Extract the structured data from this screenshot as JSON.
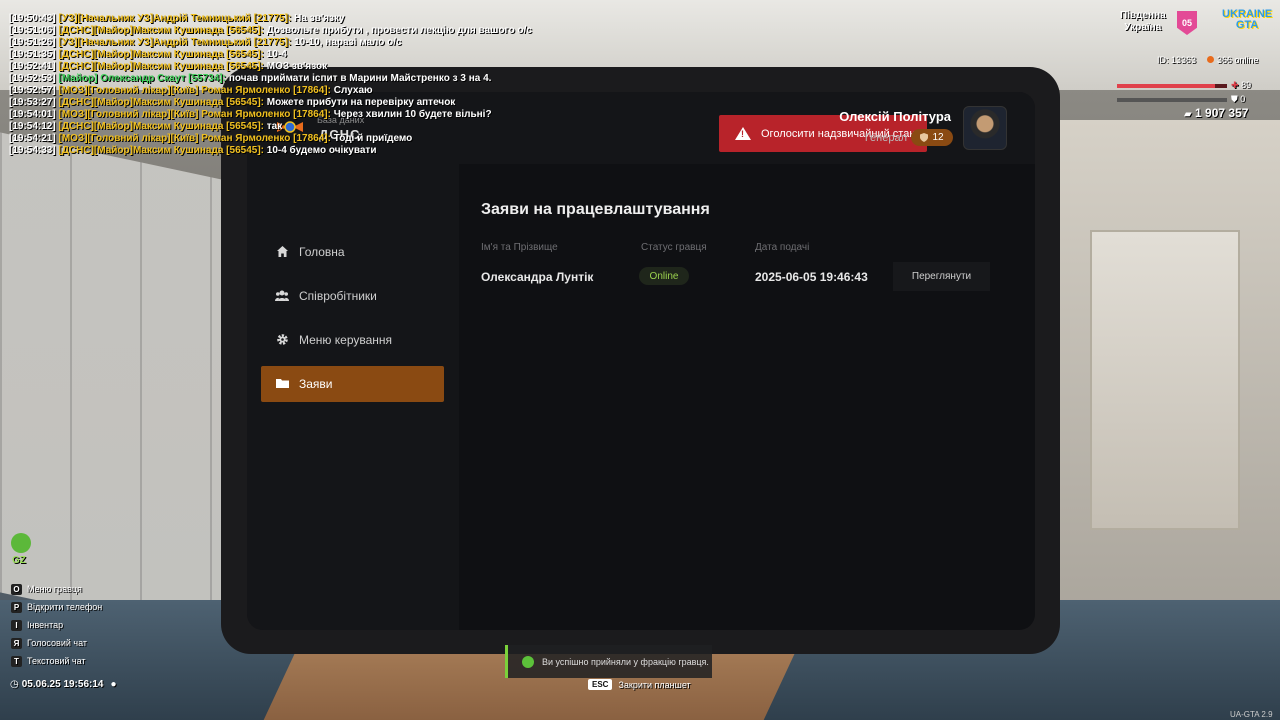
{
  "chat": [
    {
      "ts": "[19:50:43]",
      "name": "[УЗ][Начальник УЗ]Андрій Темницький [21775]:",
      "msg": "На зв'язку",
      "color": "gold"
    },
    {
      "ts": "[19:51:06]",
      "name": "[ДСНС][Майор]Максим Кушинада [56545]:",
      "msg": "Дозвольте прибути , провести лекцію для вашого о/с",
      "color": "gold"
    },
    {
      "ts": "[19:51:26]",
      "name": "[УЗ][Начальник УЗ]Андрій Темницький [21775]:",
      "msg": "10-10, наразі мало о/с",
      "color": "gold"
    },
    {
      "ts": "[19:51:35]",
      "name": "[ДСНС][Майор]Максим Кушинада [56545]:",
      "msg": "10-4",
      "color": "gold"
    },
    {
      "ts": "[19:52:41]",
      "name": "[ДСНС][Майор]Максим Кушинада [56545]:",
      "msg": "МОЗ зв'язок",
      "color": "gold"
    },
    {
      "ts": "[19:52:53]",
      "name": "[Майор] Олександр Скаут [55734]:",
      "msg": "почав приймати іспит в Марини Майстренко з 3 на 4.",
      "color": "green"
    },
    {
      "ts": "[19:52:57]",
      "name": "[МОЗ][Головний лікар][Київ] Роман Ярмоленко [17864]:",
      "msg": "Слухаю",
      "color": "gold"
    },
    {
      "ts": "[19:53:27]",
      "name": "[ДСНС][Майор]Максим Кушинада [56545]:",
      "msg": "Можете прибути на перевірку аптечок",
      "color": "gold"
    },
    {
      "ts": "[19:54:01]",
      "name": "[МОЗ][Головний лікар][Київ] Роман Ярмоленко [17864]:",
      "msg": "Через хвилин 10 будете вільні?",
      "color": "gold"
    },
    {
      "ts": "[19:54:12]",
      "name": "[ДСНС][Майор]Максим Кушинада [56545]:",
      "msg": "так",
      "color": "gold"
    },
    {
      "ts": "[19:54:21]",
      "name": "[МОЗ][Головний лікар][Київ] Роман Ярмоленко [17864]:",
      "msg": "Тоді й приїдемо",
      "color": "gold"
    },
    {
      "ts": "[19:54:33]",
      "name": "[ДСНС][Майор]Максим Кушинада [56545]:",
      "msg": "10-4 будемо очікувати",
      "color": "gold"
    }
  ],
  "hud": {
    "region": [
      "Південна",
      "Україна"
    ],
    "region_badge": "05",
    "brand": [
      "UKRAINE",
      "GTA"
    ],
    "id": "ID: 13363",
    "online": "366 online",
    "health": "89",
    "health_fraction": 0.89,
    "armor": "0",
    "money": "1 907 357",
    "gz": "GZ",
    "clock": "05.06.25 19:56:14",
    "version": "UA-GTA 2.9"
  },
  "keys": [
    {
      "key": "O",
      "label": "Меню гравця"
    },
    {
      "key": "P",
      "label": "Відкрити телефон"
    },
    {
      "key": "I",
      "label": "Інвентар"
    },
    {
      "key": "Я",
      "label": "Голосовий чат"
    },
    {
      "key": "T",
      "label": "Текстовий чат"
    }
  ],
  "tablet": {
    "brand_sub": "База даних",
    "brand_main": "ДСНС",
    "emergency_label": "Оголосити надзвичайний стан",
    "user": {
      "name": "Олексій Політура",
      "rank": "Генерал",
      "badge": "12"
    },
    "nav": [
      {
        "label": "Головна",
        "icon": "home-icon",
        "active": false
      },
      {
        "label": "Співробітники",
        "icon": "users-icon",
        "active": false
      },
      {
        "label": "Меню керування",
        "icon": "gear-icon",
        "active": false
      },
      {
        "label": "Заяви",
        "icon": "folder-icon",
        "active": true
      }
    ],
    "page_title": "Заяви на працевлаштування",
    "columns": [
      "Ім'я та Прізвище",
      "Статус гравця",
      "Дата подачі"
    ],
    "rows": [
      {
        "name": "Олександра Лунтік",
        "status": "Online",
        "date": "2025-06-05 19:46:43",
        "action": "Переглянути"
      }
    ],
    "accent": "#8a4a12"
  },
  "toast": "Ви успішно прийняли у фракцію гравця.",
  "esc": {
    "key": "ESC",
    "label": "Закрити планшет"
  }
}
